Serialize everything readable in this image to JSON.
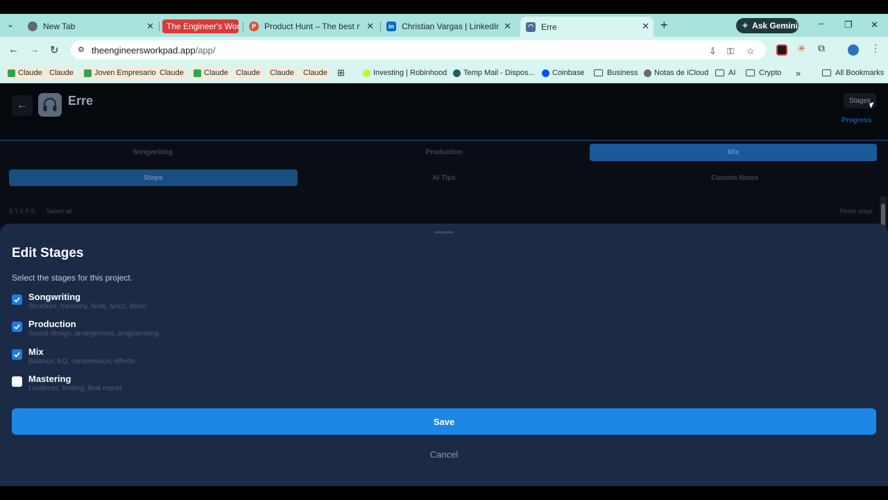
{
  "browser": {
    "tabs": [
      {
        "title": "New Tab"
      },
      {
        "title": "The Engineer's Workpad"
      },
      {
        "title": "Product Hunt – The best new products"
      },
      {
        "title": "Christian Vargas | LinkedIn"
      },
      {
        "title": "Erre"
      }
    ],
    "gemini_label": "Ask Gemini",
    "url_host": "theengineersworkpad.app",
    "url_path": "/app/",
    "bookmarks": [
      {
        "label": "Claude"
      },
      {
        "label": "Claude"
      },
      {
        "label": "Joven Empresario"
      },
      {
        "label": "Claude"
      },
      {
        "label": "Claude"
      },
      {
        "label": "Claude"
      },
      {
        "label": "Claude"
      },
      {
        "label": "Claude"
      },
      {
        "label": "Investing | Robinhood"
      },
      {
        "label": "Temp Mail - Dispos..."
      },
      {
        "label": "Coinbase"
      },
      {
        "label": "Business"
      },
      {
        "label": "Notas de iCloud"
      },
      {
        "label": "AI"
      },
      {
        "label": "Crypto"
      }
    ],
    "more_bookmarks": "»",
    "all_bookmarks": "All Bookmarks"
  },
  "app": {
    "back_glyph": "←",
    "project_title": "Erre",
    "stages_button": "Stages",
    "progress_link": "Progress",
    "stage_tabs": [
      {
        "label": "Songwriting"
      },
      {
        "label": "Production"
      },
      {
        "label": "Mix"
      }
    ],
    "sub_tabs": [
      {
        "label": "Steps"
      },
      {
        "label": "AI Tips"
      },
      {
        "label": "Custom Notes"
      }
    ],
    "steps_label": "STEPS",
    "select_all": "Select all",
    "reset_stage": "Reset stage"
  },
  "sheet": {
    "title": "Edit Stages",
    "description": "Select the stages for this project.",
    "options": [
      {
        "name": "Songwriting",
        "detail": "Structure, harmony, hook, lyrics, demo",
        "checked": true
      },
      {
        "name": "Production",
        "detail": "Sound design, arrangement, programming",
        "checked": true
      },
      {
        "name": "Mix",
        "detail": "Balance, EQ, compression, effects",
        "checked": true
      },
      {
        "name": "Mastering",
        "detail": "Loudness, limiting, final export",
        "checked": false
      }
    ],
    "save_label": "Save",
    "cancel_label": "Cancel"
  },
  "colors": {
    "accent": "#1d87e5",
    "tab_strip": "#a9e3dd",
    "sheet_bg": "#1b2a45"
  }
}
